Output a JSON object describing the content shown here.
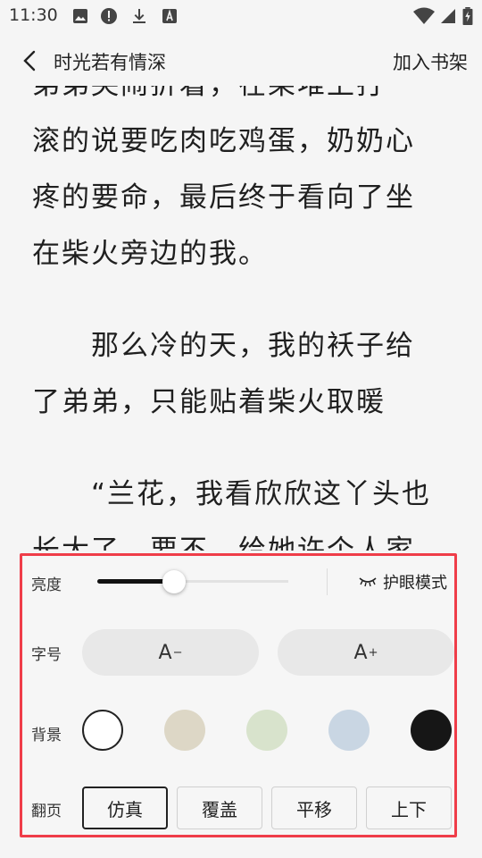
{
  "status_bar": {
    "time": "11:30"
  },
  "header": {
    "title": "时光若有情深",
    "add_to_shelf": "加入书架"
  },
  "content": {
    "lines": [
      "弟弟哭闹折着，在柴堆上打",
      "滚的说要吃肉吃鸡蛋，奶奶心",
      "疼的要命，最后终于看向了坐",
      "在柴火旁边的我。",
      "",
      "　　那么冷的天，我的袄子给",
      "了弟弟，只能贴着柴火取暖",
      "",
      "　　“兰花，我看欣欣这丫头也",
      "长大了，要不，给她许个人家"
    ]
  },
  "settings": {
    "brightness": {
      "label": "亮度",
      "value": 0.4,
      "eye_mode_label": "护眼模式"
    },
    "font_size": {
      "label": "字号",
      "decrease": "A",
      "increase": "A"
    },
    "background": {
      "label": "背景",
      "options": [
        {
          "name": "white",
          "color": "#ffffff",
          "selected": true
        },
        {
          "name": "beige",
          "color": "#ddd7c6",
          "selected": false
        },
        {
          "name": "green",
          "color": "#d8e3cc",
          "selected": false
        },
        {
          "name": "blue",
          "color": "#c9d6e3",
          "selected": false
        },
        {
          "name": "black",
          "color": "#161616",
          "selected": false
        }
      ]
    },
    "page_turn": {
      "label": "翻页",
      "options": [
        "仿真",
        "覆盖",
        "平移",
        "上下"
      ],
      "selected": "仿真"
    }
  }
}
